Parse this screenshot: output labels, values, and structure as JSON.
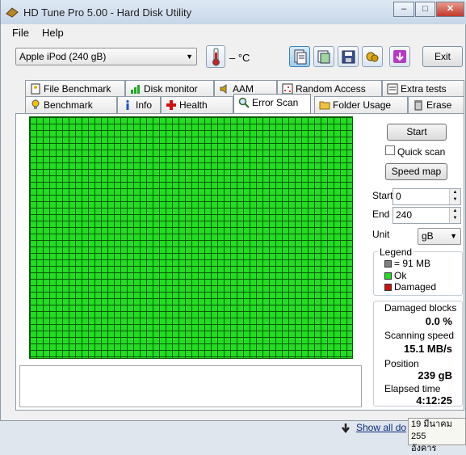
{
  "window": {
    "title": "HD Tune Pro 5.00 - Hard Disk Utility",
    "controls": {
      "minimize": "–",
      "maximize": "□",
      "close": "✕"
    }
  },
  "menu": {
    "file": "File",
    "help": "Help"
  },
  "toolbar": {
    "drive": "Apple   iPod         (240 gB)",
    "temperature": "– °C",
    "exit_label": "Exit",
    "icons": [
      "thermometer-icon",
      "copy-info-icon",
      "copy-screen-icon",
      "save-icon",
      "options-icon",
      "download-icon"
    ]
  },
  "tabs": {
    "row1": [
      "File Benchmark",
      "Disk monitor",
      "AAM",
      "Random Access",
      "Extra tests"
    ],
    "row2": [
      "Benchmark",
      "Info",
      "Health",
      "Error Scan",
      "Folder Usage",
      "Erase"
    ],
    "active": "Error Scan"
  },
  "errorscan": {
    "start_button": "Start",
    "quick_scan_label": "Quick scan",
    "quick_scan_checked": false,
    "speed_map_button": "Speed map",
    "start_label": "Start",
    "start_value": "0",
    "end_label": "End",
    "end_value": "240",
    "unit_label": "Unit",
    "unit_value": "gB",
    "legend": {
      "title": "Legend",
      "block_size": "= 91 MB",
      "ok": "Ok",
      "damaged": "Damaged",
      "colors": {
        "block": "#808080",
        "ok": "#22dd22",
        "damaged": "#cc1111"
      }
    },
    "stats": {
      "damaged_label": "Damaged blocks",
      "damaged_value": "0.0 %",
      "speed_label": "Scanning speed",
      "speed_value": "15.1 MB/s",
      "position_label": "Position",
      "position_value": "239 gB",
      "elapsed_label": "Elapsed time",
      "elapsed_value": "4:12:25"
    }
  },
  "statusbar": {
    "show_all": "Show all do",
    "tray_line1": "19 มีนาคม 255",
    "tray_line2": "อังคาร"
  }
}
